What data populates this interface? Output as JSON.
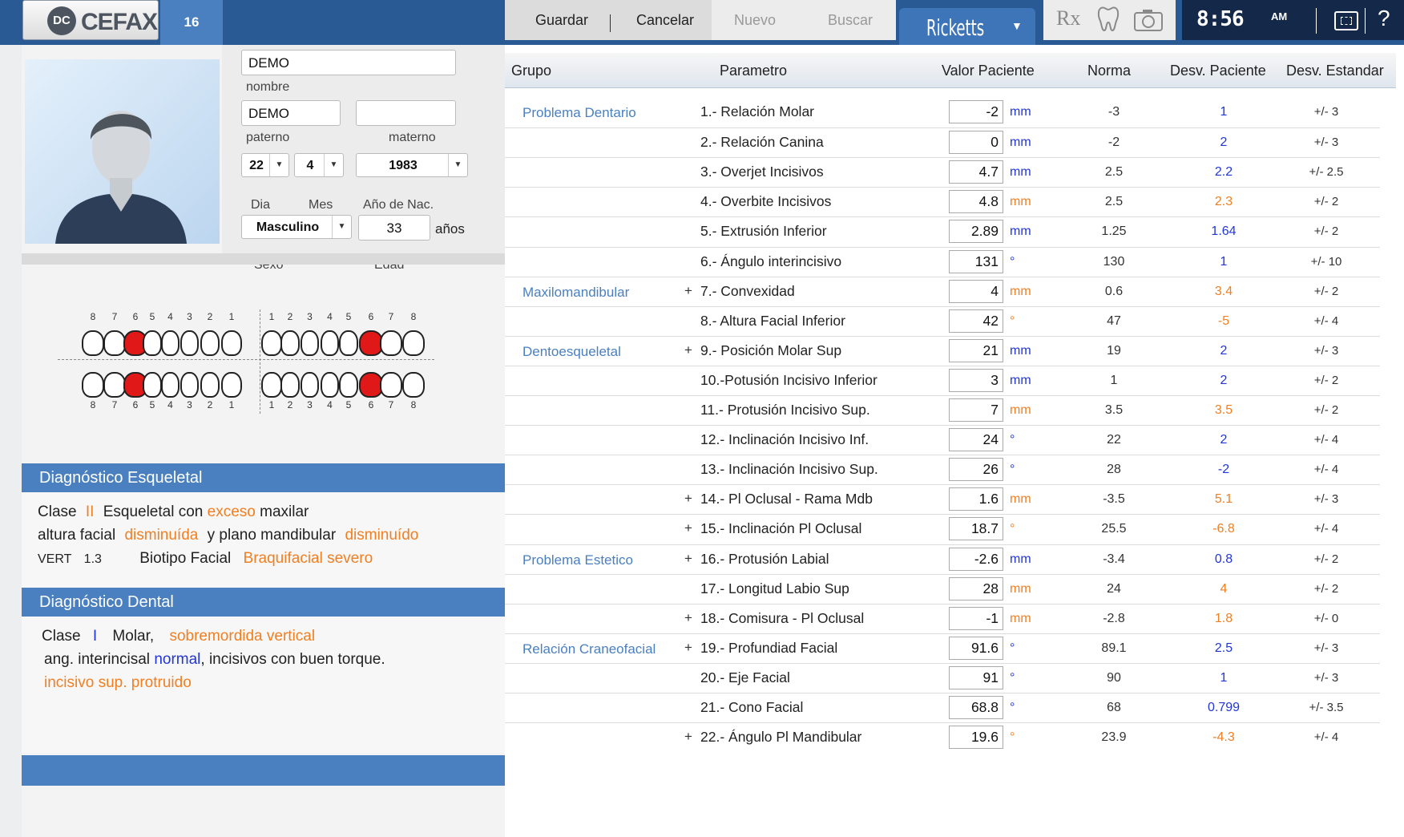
{
  "header": {
    "logo": "CEFAX",
    "logo_mark": "DC",
    "count": "16",
    "actions": [
      "Guardar",
      "Cancelar",
      "Nuevo",
      "Buscar"
    ],
    "module": "Ricketts",
    "rx_label": "Rx",
    "time": "8:56",
    "ampm": "AM",
    "help": "?"
  },
  "patient": {
    "nombre": "DEMO",
    "nombre_label": "nombre",
    "paterno": "DEMO",
    "paterno_label": "paterno",
    "materno": "",
    "materno_label": "materno",
    "dia": "22",
    "dia_label": "Dia",
    "mes": "4",
    "mes_label": "Mes",
    "anio": "1983",
    "anio_label": "Año de Nac.",
    "sexo": "Masculino",
    "sexo_label": "Sexo",
    "edad": "33",
    "edad_label": "Edad",
    "edad_unit": "años"
  },
  "teeth": {
    "upper_numbers": [
      "8",
      "7",
      "6",
      "5",
      "4",
      "3",
      "2",
      "1",
      "1",
      "2",
      "3",
      "4",
      "5",
      "6",
      "7",
      "8"
    ],
    "lower_numbers": [
      "8",
      "7",
      "6",
      "5",
      "4",
      "3",
      "2",
      "1",
      "1",
      "2",
      "3",
      "4",
      "5",
      "6",
      "7",
      "8"
    ],
    "highlighted": [
      "upper-right-6",
      "upper-left-6",
      "lower-right-6",
      "lower-left-6"
    ],
    "highlight_color": "#e01818"
  },
  "diag_esq": {
    "title": "Diagnóstico Esqueletal",
    "l1a": "Clase",
    "l1b": "II",
    "l1c": "Esqueletal con",
    "l1d": "exceso",
    "l1e": "maxilar",
    "l2a": "altura facial",
    "l2b": "disminuída",
    "l2c": "y plano mandibular",
    "l2d": "disminuído",
    "l3a": "VERT",
    "l3b": "1.3",
    "l3c": "Biotipo Facial",
    "l3d": "Braquifacial severo"
  },
  "diag_dental": {
    "title": "Diagnóstico Dental",
    "l1a": "Clase",
    "l1b": "I",
    "l1c": "Molar,",
    "l1d": "sobremordida vertical",
    "l2a": "ang. interincisal",
    "l2b": "normal",
    "l2c": ", incisivos con buen torque.",
    "l3a": "incisivo sup. protruido"
  },
  "table": {
    "headers": [
      "Grupo",
      "Parametro",
      "Valor Paciente",
      "Norma",
      "Desv. Paciente",
      "Desv. Estandar"
    ],
    "rows": [
      {
        "group": "Problema Dentario",
        "plus": "",
        "param": "1.- Relación Molar",
        "value": "-2",
        "unit": "mm",
        "unit_color": "blue",
        "norma": "-3",
        "desv": "1",
        "desv_color": "blue",
        "est": "+/- 3"
      },
      {
        "group": "",
        "plus": "",
        "param": "2.- Relación Canina",
        "value": "0",
        "unit": "mm",
        "unit_color": "blue",
        "norma": "-2",
        "desv": "2",
        "desv_color": "blue",
        "est": "+/- 3"
      },
      {
        "group": "",
        "plus": "",
        "param": "3.- Overjet Incisivos",
        "value": "4.7",
        "unit": "mm",
        "unit_color": "blue",
        "norma": "2.5",
        "desv": "2.2",
        "desv_color": "blue",
        "est": "+/- 2.5"
      },
      {
        "group": "",
        "plus": "",
        "param": "4.- Overbite Incisivos",
        "value": "4.8",
        "unit": "mm",
        "unit_color": "orange",
        "norma": "2.5",
        "desv": "2.3",
        "desv_color": "orange",
        "est": "+/- 2"
      },
      {
        "group": "",
        "plus": "",
        "param": "5.- Extrusión  Inferior",
        "value": "2.89",
        "unit": "mm",
        "unit_color": "blue",
        "norma": "1.25",
        "desv": "1.64",
        "desv_color": "blue",
        "est": "+/- 2"
      },
      {
        "group": "",
        "plus": "",
        "param": "6.- Ángulo interincisivo",
        "value": "131",
        "unit": "°",
        "unit_color": "blue",
        "norma": "130",
        "desv": "1",
        "desv_color": "blue",
        "est": "+/- 10"
      },
      {
        "group": "Maxilomandibular",
        "plus": "+",
        "param": "7.- Convexidad",
        "value": "4",
        "unit": "mm",
        "unit_color": "orange",
        "norma": "0.6",
        "desv": "3.4",
        "desv_color": "orange",
        "est": "+/- 2"
      },
      {
        "group": "",
        "plus": "",
        "param": "8.- Altura Facial Inferior",
        "value": "42",
        "unit": "°",
        "unit_color": "orange",
        "norma": "47",
        "desv": "-5",
        "desv_color": "orange",
        "est": "+/- 4"
      },
      {
        "group": "Dentoesqueletal",
        "plus": "+",
        "param": "9.- Posición Molar Sup",
        "value": "21",
        "unit": "mm",
        "unit_color": "blue",
        "norma": "19",
        "desv": "2",
        "desv_color": "blue",
        "est": "+/- 3"
      },
      {
        "group": "",
        "plus": "",
        "param": "10.-Potusión Incisivo Inferior",
        "value": "3",
        "unit": "mm",
        "unit_color": "blue",
        "norma": "1",
        "desv": "2",
        "desv_color": "blue",
        "est": "+/- 2"
      },
      {
        "group": "",
        "plus": "",
        "param": "11.- Protusión Incisivo Sup.",
        "value": "7",
        "unit": "mm",
        "unit_color": "orange",
        "norma": "3.5",
        "desv": "3.5",
        "desv_color": "orange",
        "est": "+/- 2"
      },
      {
        "group": "",
        "plus": "",
        "param": "12.- Inclinación Incisivo Inf.",
        "value": "24",
        "unit": "°",
        "unit_color": "blue",
        "norma": "22",
        "desv": "2",
        "desv_color": "blue",
        "est": "+/- 4"
      },
      {
        "group": "",
        "plus": "",
        "param": "13.- Inclinación Incisivo Sup.",
        "value": "26",
        "unit": "°",
        "unit_color": "blue",
        "norma": "28",
        "desv": "-2",
        "desv_color": "blue",
        "est": "+/- 4"
      },
      {
        "group": "",
        "plus": "+",
        "param": "14.- Pl Oclusal - Rama Mdb",
        "value": "1.6",
        "unit": "mm",
        "unit_color": "orange",
        "norma": "-3.5",
        "desv": "5.1",
        "desv_color": "orange",
        "est": "+/- 3"
      },
      {
        "group": "",
        "plus": "+",
        "param": "15.- Inclinación Pl Oclusal",
        "value": "18.7",
        "unit": "°",
        "unit_color": "orange",
        "norma": "25.5",
        "desv": "-6.8",
        "desv_color": "orange",
        "est": "+/- 4"
      },
      {
        "group": "Problema Estetico",
        "plus": "+",
        "param": "16.- Protusión Labial",
        "value": "-2.6",
        "unit": "mm",
        "unit_color": "blue",
        "norma": "-3.4",
        "desv": "0.8",
        "desv_color": "blue",
        "est": "+/- 2"
      },
      {
        "group": "",
        "plus": "",
        "param": "17.- Longitud Labio Sup",
        "value": "28",
        "unit": "mm",
        "unit_color": "orange",
        "norma": "24",
        "desv": "4",
        "desv_color": "orange",
        "est": "+/- 2"
      },
      {
        "group": "",
        "plus": "+",
        "param": "18.- Comisura - Pl Oclusal",
        "value": "-1",
        "unit": "mm",
        "unit_color": "orange",
        "norma": "-2.8",
        "desv": "1.8",
        "desv_color": "orange",
        "est": "+/- 0"
      },
      {
        "group": "Relación Craneofacial",
        "plus": "+",
        "param": "19.- Profundiad Facial",
        "value": "91.6",
        "unit": "°",
        "unit_color": "blue",
        "norma": "89.1",
        "desv": "2.5",
        "desv_color": "blue",
        "est": "+/- 3"
      },
      {
        "group": "",
        "plus": "",
        "param": "20.- Eje Facial",
        "value": "91",
        "unit": "°",
        "unit_color": "blue",
        "norma": "90",
        "desv": "1",
        "desv_color": "blue",
        "est": "+/- 3"
      },
      {
        "group": "",
        "plus": "",
        "param": "21.- Cono Facial",
        "value": "68.8",
        "unit": "°",
        "unit_color": "blue",
        "norma": "68",
        "desv": "0.799",
        "desv_color": "blue",
        "est": "+/- 3.5"
      },
      {
        "group": "",
        "plus": "+",
        "param": "22.- Ángulo Pl Mandibular",
        "value": "19.6",
        "unit": "°",
        "unit_color": "orange",
        "norma": "23.9",
        "desv": "-4.3",
        "desv_color": "orange",
        "est": "+/- 4"
      }
    ]
  },
  "icons": [
    "rx-icon",
    "tooth-icon",
    "camera-icon",
    "fullscreen-icon",
    "help-icon",
    "dropdown-arrow-icon",
    "avatar"
  ]
}
